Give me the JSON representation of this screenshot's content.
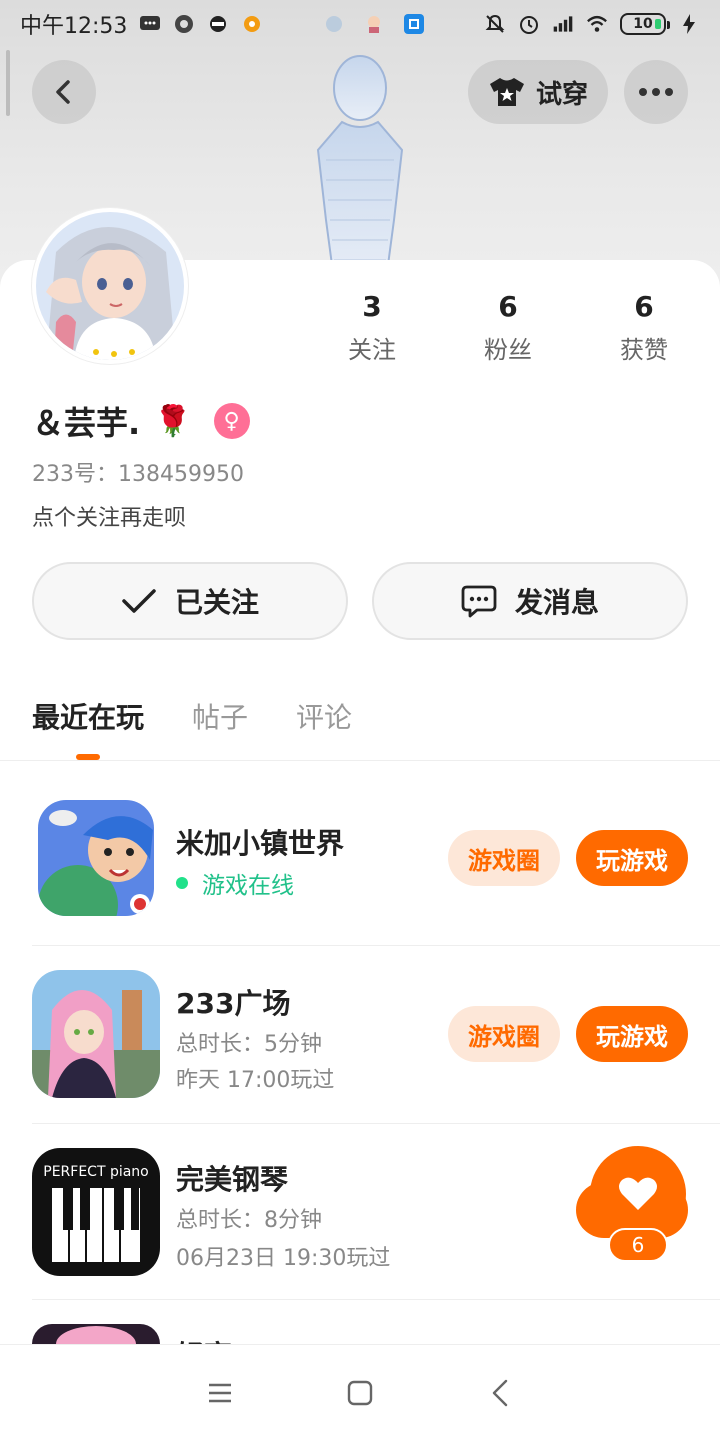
{
  "status_bar": {
    "time": "中午12:53",
    "battery": "10"
  },
  "header": {
    "tryon_label": "试穿"
  },
  "profile": {
    "stats": [
      {
        "value": "3",
        "label": "关注"
      },
      {
        "value": "6",
        "label": "粉丝"
      },
      {
        "value": "6",
        "label": "获赞"
      }
    ],
    "nickname": "＆芸芋.",
    "nickname_emoji": "🌹",
    "gender_symbol": "♀",
    "uid": "233号：138459950",
    "bio": "点个关注再走呗"
  },
  "actions": {
    "follow_label": "已关注",
    "message_label": "发消息"
  },
  "tabs": [
    {
      "label": "最近在玩",
      "active": true
    },
    {
      "label": "帖子",
      "active": false
    },
    {
      "label": "评论",
      "active": false
    }
  ],
  "games": [
    {
      "name": "米加小镇世界",
      "status": "游戏在线",
      "circle_label": "游戏圈",
      "play_label": "玩游戏"
    },
    {
      "name": "233广场",
      "duration": "总时长：5分钟",
      "last_played": "昨天 17:00玩过",
      "circle_label": "游戏圈",
      "play_label": "玩游戏"
    },
    {
      "name": "完美钢琴",
      "duration": "总时长：8分钟",
      "last_played": "06月23日 19:30玩过",
      "icon_text": "PERFECT piano"
    },
    {
      "name": "轻享Y"
    }
  ],
  "like": {
    "count": "6"
  },
  "colors": {
    "accent": "#ff6a00",
    "online": "#21c18a",
    "gender": "#ff6f96"
  }
}
